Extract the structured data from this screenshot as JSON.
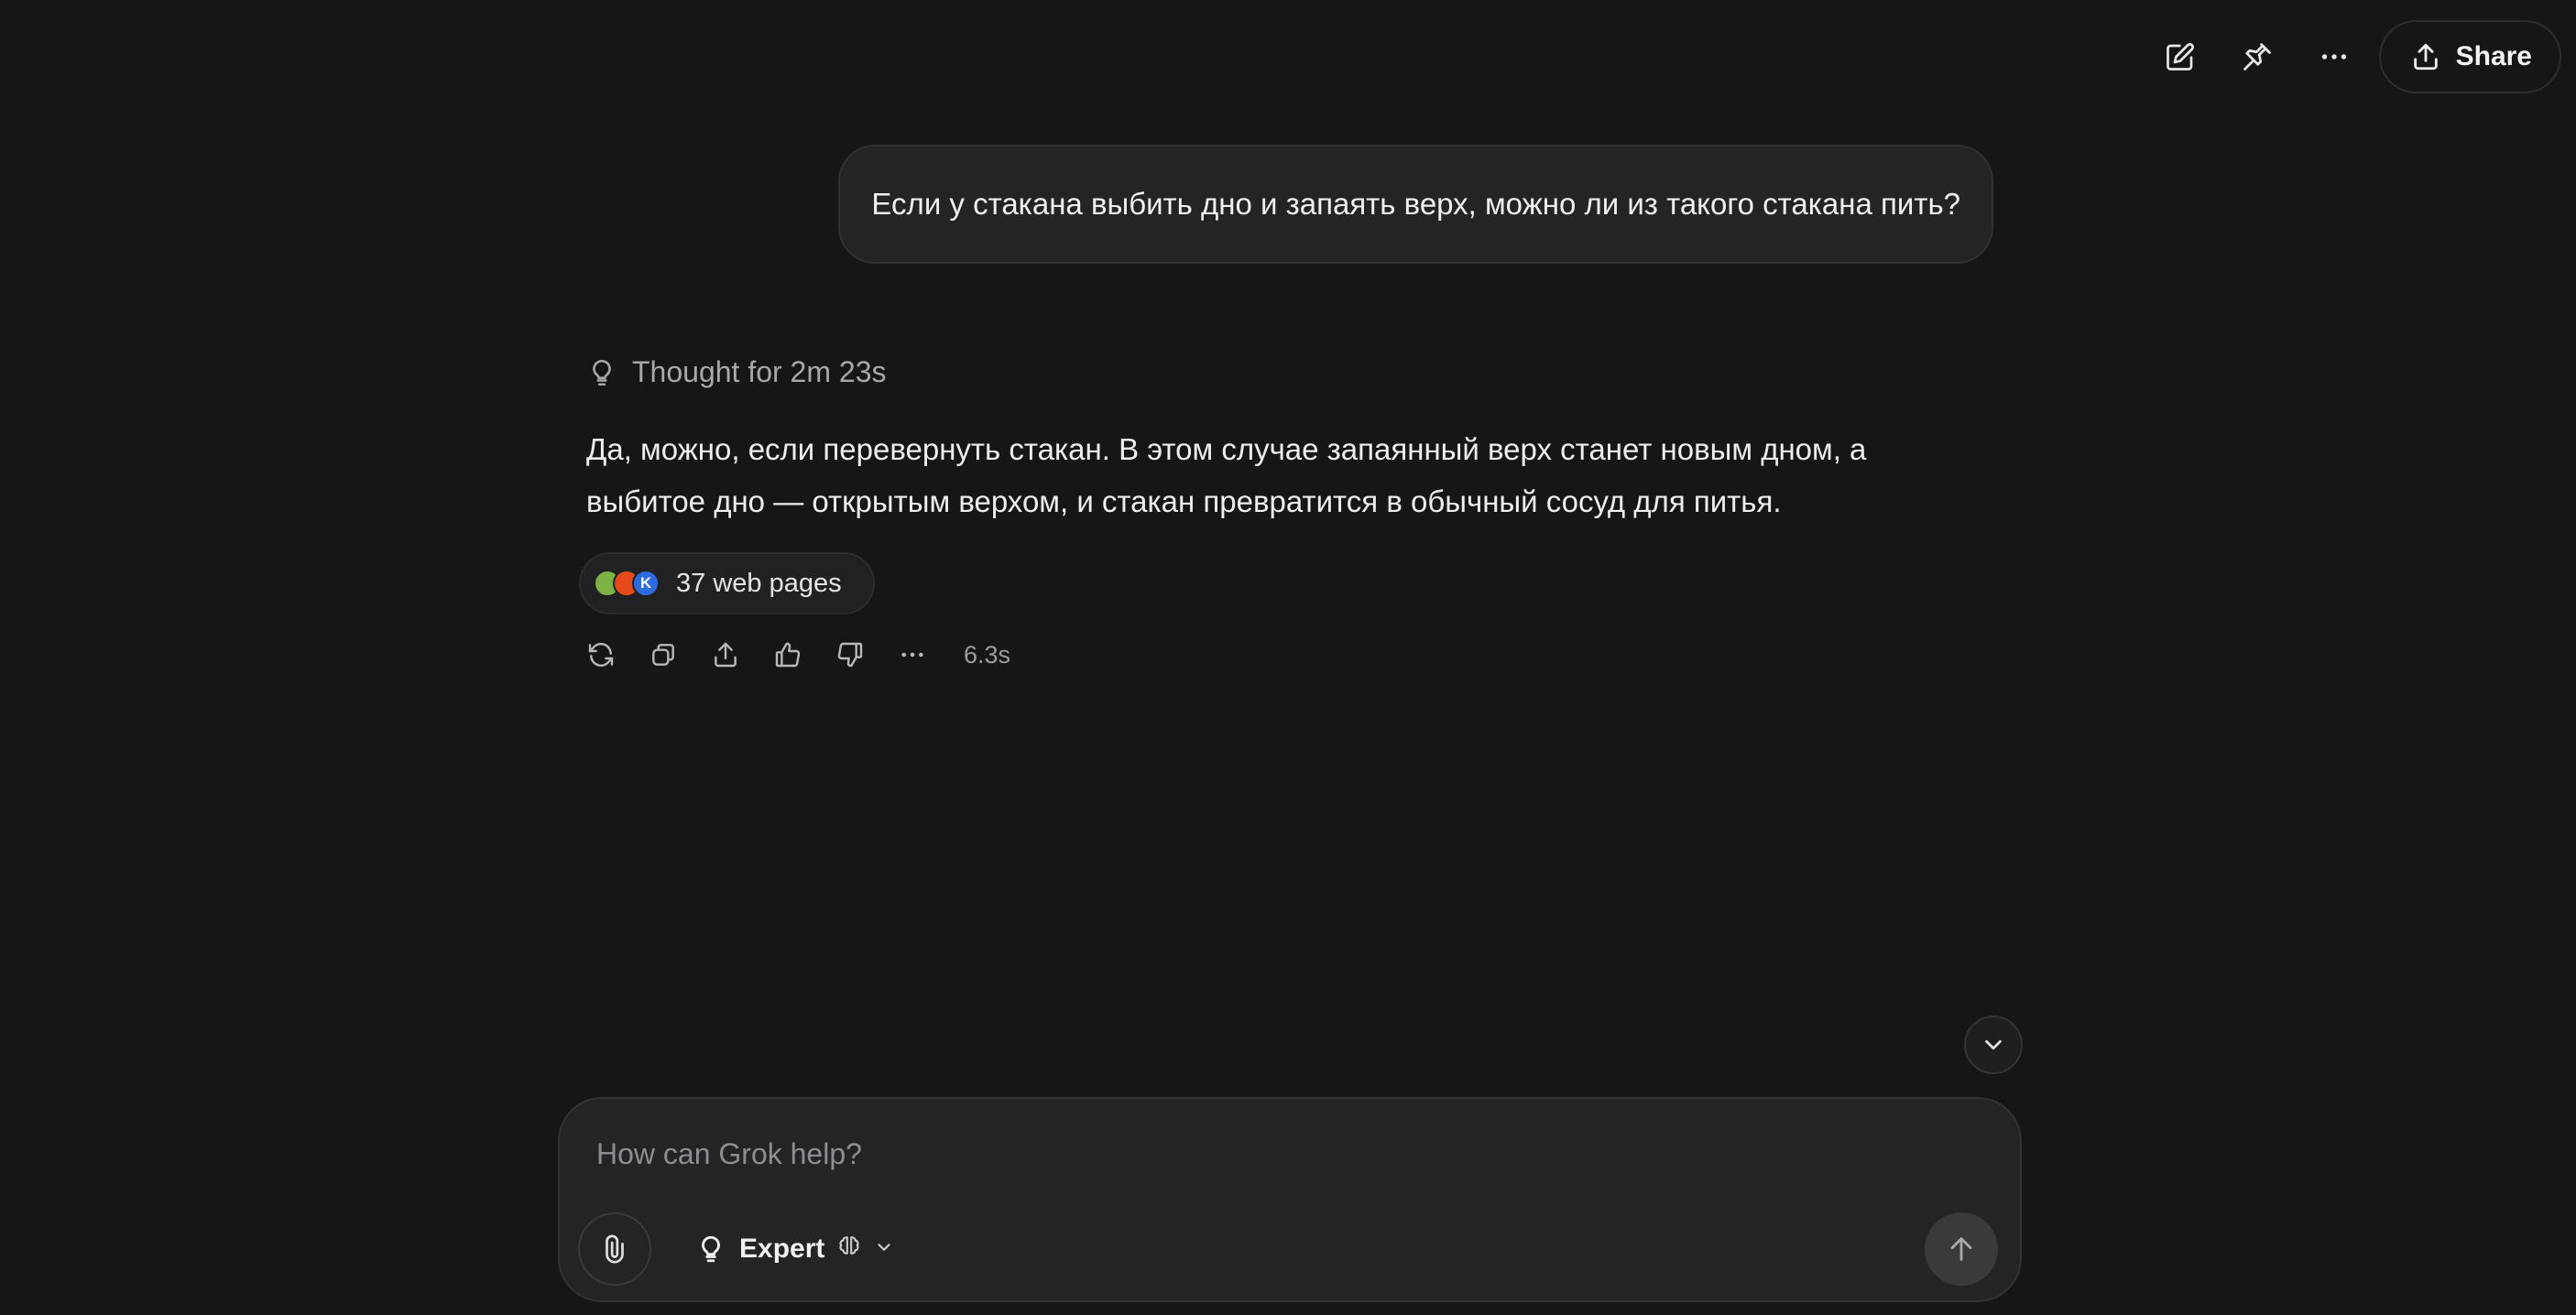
{
  "header": {
    "share_label": "Share",
    "icons": [
      "edit-icon",
      "pin-icon",
      "more-icon",
      "share-icon"
    ]
  },
  "conversation": {
    "user_message": "Если у стакана выбить дно и запаять верх, можно ли из такого стакана пить?",
    "thought_label": "Thought for 2m 23s",
    "answer": "Да, можно, если перевернуть стакан. В этом случае запаянный верх станет новым дном, а выбитое дно — открытым верхом, и стакан превратится в обычный сосуд для питья.",
    "sources": {
      "label": "37 web pages",
      "favicons": [
        {
          "name": "favicon-1",
          "color": "#7cb342",
          "glyph": ""
        },
        {
          "name": "favicon-2",
          "color": "#e64a19",
          "glyph": ""
        },
        {
          "name": "favicon-3",
          "color": "#2d6be0",
          "glyph": "K"
        }
      ]
    },
    "response_time": "6.3s",
    "actions": [
      "regenerate-icon",
      "copy-icon",
      "share-icon",
      "thumbs-up-icon",
      "thumbs-down-icon",
      "more-icon"
    ]
  },
  "composer": {
    "placeholder": "How can Grok help?",
    "model_label": "Expert"
  },
  "colors": {
    "background": "#161618",
    "surface": "#242427",
    "text": "#ececec",
    "muted": "#a8a8ab"
  }
}
